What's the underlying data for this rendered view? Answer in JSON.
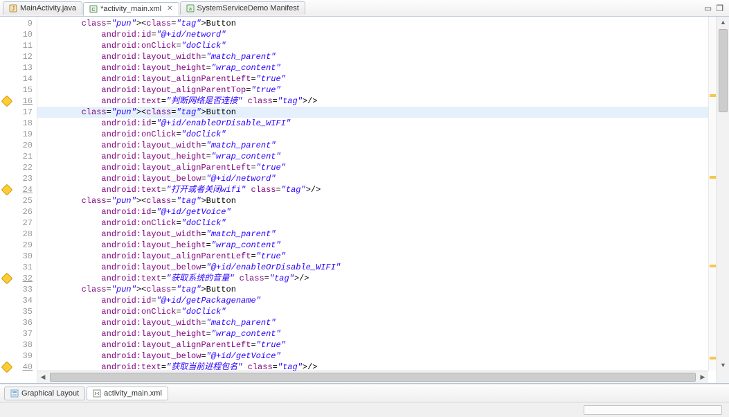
{
  "tabs": {
    "t0": {
      "label": "MainActivity.java"
    },
    "t1": {
      "label": "*activity_main.xml"
    },
    "t2": {
      "label": "SystemServiceDemo Manifest"
    }
  },
  "bottom_tabs": {
    "b0": {
      "label": "Graphical Layout"
    },
    "b1": {
      "label": "activity_main.xml"
    }
  },
  "lines": {
    "l9": {
      "num": "9",
      "text": "        <Button"
    },
    "l10": {
      "num": "10",
      "text": "            android:id=\"@+id/netword\""
    },
    "l11": {
      "num": "11",
      "text": "            android:onClick=\"doClick\""
    },
    "l12": {
      "num": "12",
      "text": "            android:layout_width=\"match_parent\""
    },
    "l13": {
      "num": "13",
      "text": "            android:layout_height=\"wrap_content\""
    },
    "l14": {
      "num": "14",
      "text": "            android:layout_alignParentLeft=\"true\""
    },
    "l15": {
      "num": "15",
      "text": "            android:layout_alignParentTop=\"true\""
    },
    "l16": {
      "num": "16",
      "text": "            android:text=\"判断网络是否连接\" />"
    },
    "l17": {
      "num": "17",
      "text": "        <Button"
    },
    "l18": {
      "num": "18",
      "text": "            android:id=\"@+id/enableOrDisable_WIFI\""
    },
    "l19": {
      "num": "19",
      "text": "            android:onClick=\"doClick\""
    },
    "l20": {
      "num": "20",
      "text": "            android:layout_width=\"match_parent\""
    },
    "l21": {
      "num": "21",
      "text": "            android:layout_height=\"wrap_content\""
    },
    "l22": {
      "num": "22",
      "text": "            android:layout_alignParentLeft=\"true\""
    },
    "l23": {
      "num": "23",
      "text": "            android:layout_below=\"@+id/netword\""
    },
    "l24": {
      "num": "24",
      "text": "            android:text=\"打开或者关闭wifi\" />"
    },
    "l25": {
      "num": "25",
      "text": "        <Button"
    },
    "l26": {
      "num": "26",
      "text": "            android:id=\"@+id/getVoice\""
    },
    "l27": {
      "num": "27",
      "text": "            android:onClick=\"doClick\""
    },
    "l28": {
      "num": "28",
      "text": "            android:layout_width=\"match_parent\""
    },
    "l29": {
      "num": "29",
      "text": "            android:layout_height=\"wrap_content\""
    },
    "l30": {
      "num": "30",
      "text": "            android:layout_alignParentLeft=\"true\""
    },
    "l31": {
      "num": "31",
      "text": "            android:layout_below=\"@+id/enableOrDisable_WIFI\""
    },
    "l32": {
      "num": "32",
      "text": "            android:text=\"获取系统的音量\" />"
    },
    "l33": {
      "num": "33",
      "text": "        <Button"
    },
    "l34": {
      "num": "34",
      "text": "            android:id=\"@+id/getPackagename\""
    },
    "l35": {
      "num": "35",
      "text": "            android:onClick=\"doClick\""
    },
    "l36": {
      "num": "36",
      "text": "            android:layout_width=\"match_parent\""
    },
    "l37": {
      "num": "37",
      "text": "            android:layout_height=\"wrap_content\""
    },
    "l38": {
      "num": "38",
      "text": "            android:layout_alignParentLeft=\"true\""
    },
    "l39": {
      "num": "39",
      "text": "            android:layout_below=\"@+id/getVoice\""
    },
    "l40": {
      "num": "40",
      "text": "            android:text=\"获取当前进程包名\" />"
    }
  }
}
